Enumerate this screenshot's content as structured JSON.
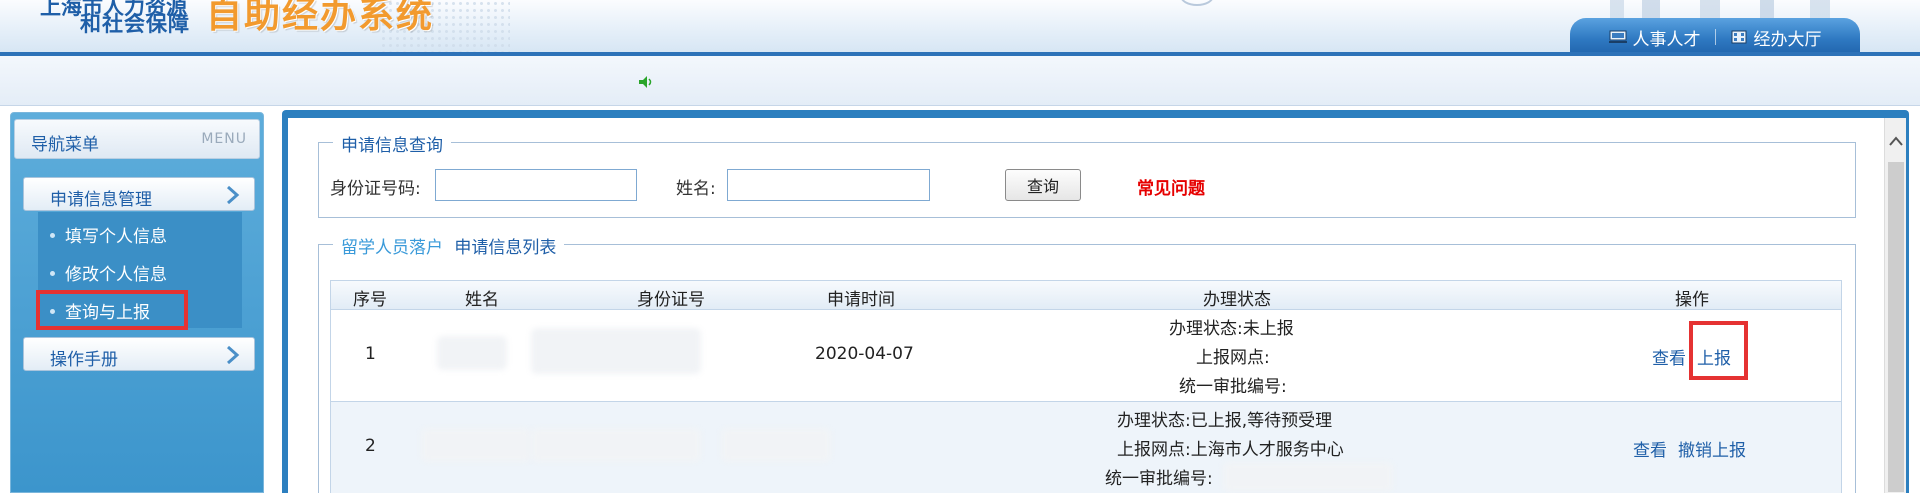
{
  "header": {
    "logo_line1": "上海市人力资源",
    "logo_line2": "和社会保障",
    "logo_big": "自助经办系统",
    "tabs": [
      {
        "label": "人事人才",
        "icon": "monitor-icon"
      },
      {
        "label": "经办大厅",
        "icon": "building-icon"
      }
    ]
  },
  "sidebar": {
    "title": "导航菜单",
    "title_en": "MENU",
    "groups": [
      {
        "label": "申请信息管理"
      },
      {
        "label": "操作手册"
      }
    ],
    "items": [
      {
        "label": "填写个人信息"
      },
      {
        "label": "修改个人信息"
      },
      {
        "label": "查询与上报"
      }
    ]
  },
  "query": {
    "legend": "申请信息查询",
    "id_label": "身份证号码:",
    "id_value": "",
    "name_label": "姓名:",
    "name_value": "",
    "button": "查询",
    "faq": "常见问题"
  },
  "list": {
    "legend_prefix": "留学人员落户",
    "legend_suffix": "申请信息列表",
    "columns": [
      "序号",
      "姓名",
      "身份证号",
      "申请时间",
      "办理状态",
      "操作"
    ],
    "rows": [
      {
        "seq": "1",
        "date": "2020-04-07",
        "status_line1": "办理状态:未上报",
        "status_line2": "上报网点:",
        "status_line3": "统一审批编号:",
        "op_view": "查看",
        "op_action": "上报"
      },
      {
        "seq": "2",
        "date": "",
        "status_line1": "办理状态:已上报,等待预受理",
        "status_line2": "上报网点:上海市人才服务中心",
        "status_line3": "统一审批编号:",
        "op_view": "查看",
        "op_action": "撤销上报"
      }
    ]
  },
  "colors": {
    "primary": "#2c7fbf",
    "highlight": "#e53232",
    "faq": "#e60000",
    "logo_orange": "#f29a2e"
  }
}
